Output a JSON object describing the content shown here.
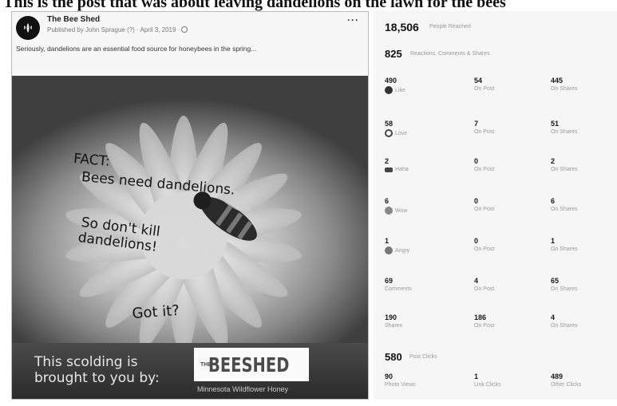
{
  "caption": "This is the post that was about leaving dandelions on the lawn for the bees",
  "post": {
    "page_name": "The Bee Shed",
    "published_line": "Published by John Sprague (?) · April 3, 2019 ·",
    "text": "Seriously, dandelions are an essential food source for honeybees in the spring...",
    "more_label": "···",
    "image": {
      "fact_line1": "FACT:",
      "fact_line2": "Bees need dandelions.",
      "dont_line1": "So don't kill",
      "dont_line2": "dandelions!",
      "got_it": "Got it?",
      "banner_line1": "This scolding is",
      "banner_line2": "brought to you by:",
      "logo_the": "THE",
      "logo_name": "BEESHED",
      "banner_sub": "Minnesota Wildflower Honey"
    }
  },
  "insights": {
    "reach_value": "18,506",
    "reach_label": "People Reached",
    "engagement_value": "825",
    "engagement_label": "Reactions, Comments & Shares",
    "rows": [
      {
        "icon": "like-icon",
        "c1_value": "490",
        "c1_label": "Like",
        "c2_value": "54",
        "c2_label": "On Post",
        "c3_value": "445",
        "c3_label": "On Shares"
      },
      {
        "icon": "love-icon",
        "c1_value": "58",
        "c1_label": "Love",
        "c2_value": "7",
        "c2_label": "On Post",
        "c3_value": "51",
        "c3_label": "On Shares"
      },
      {
        "icon": "haha-icon",
        "c1_value": "2",
        "c1_label": "Haha",
        "c2_value": "0",
        "c2_label": "On Post",
        "c3_value": "2",
        "c3_label": "On Shares"
      },
      {
        "icon": "wow-icon",
        "c1_value": "6",
        "c1_label": "Wow",
        "c2_value": "0",
        "c2_label": "On Post",
        "c3_value": "6",
        "c3_label": "On Shares"
      },
      {
        "icon": "angry-icon",
        "c1_value": "1",
        "c1_label": "Angry",
        "c2_value": "0",
        "c2_label": "On Post",
        "c3_value": "1",
        "c3_label": "On Shares"
      },
      {
        "icon": "",
        "c1_value": "69",
        "c1_label": "Comments",
        "c2_value": "4",
        "c2_label": "On Post",
        "c3_value": "65",
        "c3_label": "On Shares"
      },
      {
        "icon": "",
        "c1_value": "190",
        "c1_label": "Shares",
        "c2_value": "186",
        "c2_label": "On Post",
        "c3_value": "4",
        "c3_label": "On Shares"
      }
    ],
    "clicks_value": "580",
    "clicks_label": "Post Clicks",
    "clicks_row": {
      "c1_value": "90",
      "c1_label": "Photo Views",
      "c2_value": "1",
      "c2_label": "Link Clicks",
      "c3_value": "489",
      "c3_label": "Other Clicks"
    }
  }
}
